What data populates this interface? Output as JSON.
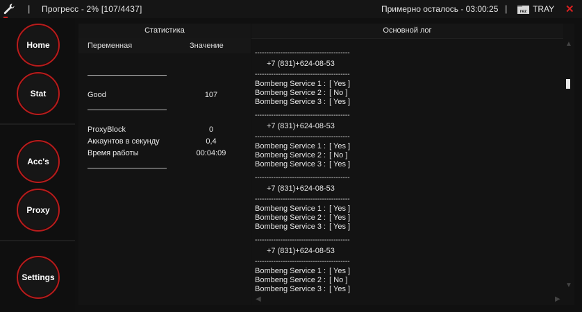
{
  "titlebar": {
    "sep": "|",
    "progress": "Прогресс - 2%  [107/4437]",
    "remaining": "Примерно осталось - 03:00:25",
    "tray_icon_text": "rez",
    "tray_label": "TRAY",
    "close": "✕"
  },
  "nav": {
    "home": "Home",
    "stat": "Stat",
    "accs": "Acc's",
    "proxy": "Proxy",
    "settings": "Settings"
  },
  "stats": {
    "title": "Статистика",
    "col_variable": "Переменная",
    "col_value": "Значение",
    "rows": [
      {
        "name": "Good",
        "value": "107"
      },
      {
        "name": "ProxyBlock",
        "value": "0"
      },
      {
        "name": "Аккаунтов в секунду",
        "value": "0,4"
      },
      {
        "name": "Время работы",
        "value": "00:04:09"
      }
    ]
  },
  "log": {
    "title": "Основной лог",
    "dashes": "-----------------------------------------",
    "entries": [
      {
        "phone": "+7 (831)+624-08-53",
        "services": [
          {
            "name": "Bombeng Service 1 :",
            "status": "[ Yes ]"
          },
          {
            "name": "Bombeng Service 2 :",
            "status": "[ No ]"
          },
          {
            "name": "Bombeng Service 3 :",
            "status": "[ Yes ]"
          }
        ]
      },
      {
        "phone": "+7 (831)+624-08-53",
        "services": [
          {
            "name": "Bombeng Service 1 :",
            "status": "[ Yes ]"
          },
          {
            "name": "Bombeng Service 2 :",
            "status": "[ No ]"
          },
          {
            "name": "Bombeng Service 3 :",
            "status": "[ Yes ]"
          }
        ]
      },
      {
        "phone": "+7 (831)+624-08-53",
        "services": [
          {
            "name": "Bombeng Service 1 :",
            "status": "[ Yes ]"
          },
          {
            "name": "Bombeng Service 2 :",
            "status": "[ Yes ]"
          },
          {
            "name": "Bombeng Service 3 :",
            "status": "[ Yes ]"
          }
        ]
      },
      {
        "phone": "+7 (831)+624-08-53",
        "services": [
          {
            "name": "Bombeng Service 1 :",
            "status": "[ Yes ]"
          },
          {
            "name": "Bombeng Service 2 :",
            "status": "[ No ]"
          },
          {
            "name": "Bombeng Service 3 :",
            "status": "[ Yes ]"
          }
        ]
      }
    ]
  },
  "colors": {
    "accent_red": "#b71c1c",
    "background": "#101010",
    "panel": "#131313"
  }
}
